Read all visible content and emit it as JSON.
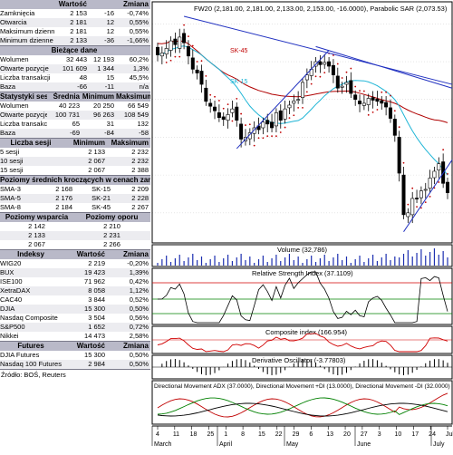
{
  "market_table": {
    "headers": [
      "",
      "Wartość",
      "Zmiana"
    ],
    "rows": [
      [
        "Zamknięcia",
        "2 153",
        "-16",
        "-0,74%"
      ],
      [
        "Otwarcia",
        "2 181",
        "12",
        "0,55%"
      ],
      [
        "Maksimum dzienne",
        "2 181",
        "12",
        "0,55%"
      ],
      [
        "Minimum dzienne",
        "2 133",
        "-36",
        "-1,66%"
      ]
    ]
  },
  "session_data": {
    "header": "Bieżące dane",
    "rows": [
      [
        "Wolumen",
        "32 443",
        "12 193",
        "60,2%"
      ],
      [
        "Otwarte pozycje",
        "101 609",
        "1 344",
        "1,3%"
      ],
      [
        "Liczba transakcji",
        "48",
        "15",
        "45,5%"
      ],
      [
        "Baza",
        "-66",
        "-11",
        "n/a"
      ]
    ]
  },
  "sessions_stats": {
    "headers": [
      "Statystyki sesji",
      "Średnia",
      "Minimum",
      "Maksimum"
    ],
    "rows": [
      [
        "Wolumen",
        "40 223",
        "20 250",
        "66 549"
      ],
      [
        "Otwarte pozycje",
        "100 731",
        "96 263",
        "108 549"
      ],
      [
        "Liczba transakcji",
        "65",
        "31",
        "132"
      ],
      [
        "Baza",
        "-69",
        "-84",
        "-58"
      ]
    ]
  },
  "range_stats": {
    "headers": [
      "Liczba sesji",
      "Minimum",
      "Maksimum"
    ],
    "rows": [
      [
        "5 sesji",
        "2 133",
        "2 232"
      ],
      [
        "10 sesji",
        "2 067",
        "2 232"
      ],
      [
        "15 sesji",
        "2 067",
        "2 388"
      ]
    ]
  },
  "moving_averages": {
    "header": "Poziomy średnich kroczących w cenach zamknięcia",
    "rows": [
      [
        "SMA-3",
        "2 168",
        "SK-15",
        "2 209"
      ],
      [
        "SMA-5",
        "2 176",
        "SK-21",
        "2 228"
      ],
      [
        "SMA-8",
        "2 184",
        "SK-45",
        "2 267"
      ]
    ]
  },
  "support_resistance": {
    "headers": [
      "Poziomy wsparcia",
      "Poziomy oporu"
    ],
    "rows": [
      [
        "2 142",
        "2 210"
      ],
      [
        "2 133",
        "2 231"
      ],
      [
        "2 067",
        "2 266"
      ]
    ]
  },
  "indices": {
    "headers": [
      "Indeksy",
      "Wartość",
      "Zmiana"
    ],
    "rows": [
      [
        "WIG20",
        "2 219",
        "-0,20%"
      ],
      [
        "BUX",
        "19 423",
        "1,39%"
      ],
      [
        "ISE100",
        "71 962",
        "0,42%"
      ],
      [
        "XetraDAX",
        "8 058",
        "1,12%"
      ],
      [
        "CAC40",
        "3 844",
        "0,52%"
      ],
      [
        "DJIA",
        "15 300",
        "0,50%"
      ],
      [
        "Nasdaq Composite",
        "3 504",
        "0,56%"
      ],
      [
        "S&P500",
        "1 652",
        "0,72%"
      ],
      [
        "Nikkei",
        "14 473",
        "2,58%"
      ]
    ]
  },
  "futures": {
    "headers": [
      "Futures",
      "Wartość",
      "Zmiana"
    ],
    "rows": [
      [
        "DJIA Futures",
        "15 300",
        "0,50%"
      ],
      [
        "Nasdaq 100 Futures",
        "2 984",
        "0,50%"
      ]
    ]
  },
  "footer": {
    "source": "Źródło: BOŚ, Reuters"
  },
  "chart_panels": {
    "price_title": "FW20 (2,181.00, 2,181.00, 2,133.00, 2,153.00, -16.0000), Parabolic SAR (2,073.53)",
    "sk45_label": "SK-45",
    "sk15_label": "SK-15",
    "volume_title": "Volume (32,786)",
    "rsi_title": "Relative Strength Index (37.1109)",
    "composite_title": "Composite index (166.954)",
    "derivative_title": "Derivative Oscillator (-3.77803)",
    "adx_title": "Directional Movement ADX (37.0000), Directional Movement +DI (13.0000), Directional Movement -DI (32.0000)",
    "date_labels": [
      "4",
      "11",
      "18",
      "25",
      "1",
      "8",
      "15",
      "22",
      "29",
      "6",
      "13",
      "20",
      "27",
      "3",
      "10",
      "17",
      "24",
      "July"
    ],
    "month_labels": [
      "March",
      "April",
      "May",
      "June",
      "July"
    ]
  },
  "chart_data": {
    "type": "candlestick",
    "title": "FW20 (2,181.00, 2,181.00, 2,133.00, 2,153.00, -16.0000), Parabolic SAR (2,073.53)",
    "last_close": 2153,
    "ohlc": {
      "open": [
        2538,
        2515,
        2520,
        2530,
        2560,
        2535,
        2575,
        2540,
        2510,
        2478,
        2475,
        2430,
        2390,
        2380,
        2365,
        2354,
        2345,
        2365,
        2380,
        2335,
        2290,
        2296,
        2310,
        2330,
        2325,
        2345,
        2340,
        2330,
        2370,
        2348,
        2378,
        2390,
        2400,
        2405,
        2452,
        2463,
        2488,
        2500,
        2493,
        2500,
        2490,
        2462,
        2432,
        2440,
        2450,
        2412,
        2396,
        2384,
        2386,
        2405,
        2401,
        2397,
        2392,
        2378,
        2348,
        2300,
        2200,
        2090,
        2095,
        2139,
        2140,
        2160,
        2165,
        2193,
        2213,
        2235,
        2181
      ],
      "close": [
        2518,
        2523,
        2535,
        2555,
        2545,
        2565,
        2550,
        2515,
        2480,
        2470,
        2440,
        2395,
        2382,
        2370,
        2352,
        2347,
        2360,
        2375,
        2345,
        2295,
        2300,
        2312,
        2325,
        2320,
        2340,
        2335,
        2325,
        2365,
        2345,
        2375,
        2385,
        2396,
        2400,
        2445,
        2465,
        2480,
        2500,
        2492,
        2498,
        2488,
        2465,
        2430,
        2435,
        2445,
        2416,
        2400,
        2388,
        2390,
        2403,
        2398,
        2395,
        2390,
        2380,
        2350,
        2305,
        2205,
        2095,
        2100,
        2138,
        2138,
        2158,
        2162,
        2192,
        2210,
        2230,
        2178,
        2153
      ]
    },
    "sar_last": 2073.53,
    "volume_last": 32786,
    "rsi_last": 37.1109,
    "composite_last": 166.954,
    "derivative_oscillator_last": -3.77803,
    "adx": {
      "ADX": 37,
      "+DI": 13,
      "-DI": 32
    }
  }
}
